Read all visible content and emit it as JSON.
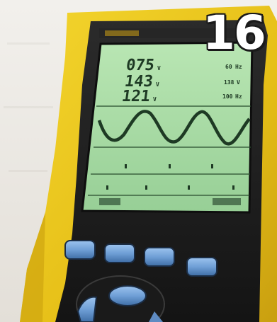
{
  "badge": {
    "number": "16"
  },
  "meter": {
    "readings": [
      {
        "value": "075",
        "unit": "V",
        "right_value": "60",
        "right_unit": "Hz"
      },
      {
        "value": "143",
        "unit": "V",
        "right_value": "138",
        "right_unit": "V"
      },
      {
        "value": "121",
        "unit": "V",
        "right_value": "100",
        "right_unit": "Hz"
      }
    ],
    "colors": {
      "case_yellow": "#e9c31b",
      "bezel": "#1d1d1d",
      "screen_green": "#a8d9a5",
      "trace": "#1e3a24",
      "button_blue": "#6f9fd6"
    },
    "buttons": [
      "f1-button",
      "f2-button",
      "f3-button",
      "f4-button"
    ],
    "icons": [
      "arrow-keypad-icon"
    ]
  }
}
